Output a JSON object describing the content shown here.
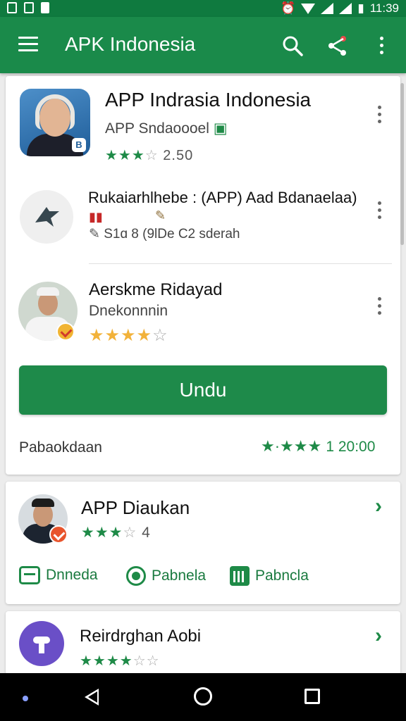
{
  "status_bar": {
    "time": "11:39"
  },
  "app_bar": {
    "title": "APK Indonesia"
  },
  "featured": {
    "title": "APP Indrasia Indonesia",
    "developer": "APP Sndaoooel",
    "rating_text": "2.50",
    "stars": {
      "filled": 3,
      "empty": 1
    }
  },
  "item2": {
    "title": "Rukaiarhlhebe : (APP) Aad Bdanaelaa)",
    "info": "S1ɑ 8  (9lDe C2 sderah"
  },
  "item3": {
    "title": "Aerskme Ridayad",
    "subtitle": "Dnekonnnin",
    "stars": {
      "filled": 4,
      "empty": 1
    }
  },
  "install_button": {
    "label": "Undu"
  },
  "footer": {
    "label": "Pabaokdaan",
    "rating_count": "1  20:00",
    "stars": {
      "filled": 4
    }
  },
  "card2": {
    "title": "APP Diaukan",
    "rating_text": "4",
    "stars": {
      "filled": 3,
      "empty": 1
    },
    "actions": [
      {
        "label": "Dnneda",
        "icon": "chat-icon"
      },
      {
        "label": "Pabnela",
        "icon": "camera-icon"
      },
      {
        "label": "Pabncla",
        "icon": "grid-icon"
      }
    ]
  },
  "card3": {
    "title": "Reirdrghan Aobi"
  },
  "colors": {
    "primary": "#1a8a4a",
    "status_bar": "#0f7a3f",
    "star_green": "#1e8a47",
    "star_orange": "#f2b23a"
  }
}
